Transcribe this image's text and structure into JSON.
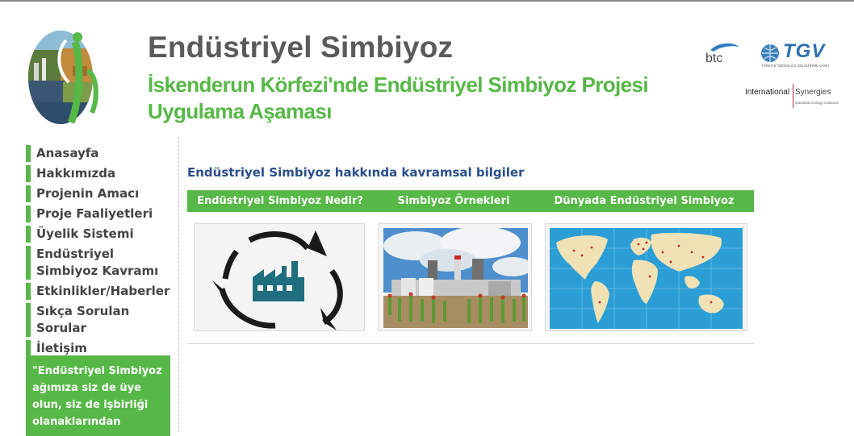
{
  "header": {
    "title": "Endüstriyel Simbiyoz",
    "subtitle": "İskenderun Körfezi'nde Endüstriyel Simbiyoz Projesi Uygulama Aşaması"
  },
  "partners": {
    "btc": "btc",
    "tgv": "TGV",
    "tgv_sub": "TÜRKİYE TEKNOLOJİ GELİŞTİRME VAKFI",
    "is_left": "International",
    "is_right": "Synergies",
    "is_sub": "industrial ecology solutions"
  },
  "nav": {
    "items": [
      {
        "label": "Anasayfa"
      },
      {
        "label": "Hakkımızda"
      },
      {
        "label": "Projenin Amacı"
      },
      {
        "label": "Proje Faaliyetleri"
      },
      {
        "label": "Üyelik Sistemi"
      },
      {
        "label": "Endüstriyel Simbiyoz Kavramı"
      },
      {
        "label": "Etkinlikler/Haberler"
      },
      {
        "label": "Sıkça Sorulan Sorular"
      },
      {
        "label": "İletişim"
      }
    ]
  },
  "quote": "\"Endüstriyel Simbiyoz ağımıza siz de üye olun, siz de işbirliği olanaklarından",
  "main": {
    "heading": "Endüstriyel Simbiyoz hakkında kavramsal bilgiler",
    "tabs": [
      {
        "label": "Endüstriyel Simbiyoz Nedir?"
      },
      {
        "label": "Simbiyoz Örnekleri"
      },
      {
        "label": "Dünyada Endüstriyel Simbiyoz"
      }
    ]
  },
  "colors": {
    "brand_green": "#56b846",
    "heading_blue": "#2b4f8c",
    "title_gray": "#5a5a5a",
    "factory_teal": "#1f6e7e"
  }
}
